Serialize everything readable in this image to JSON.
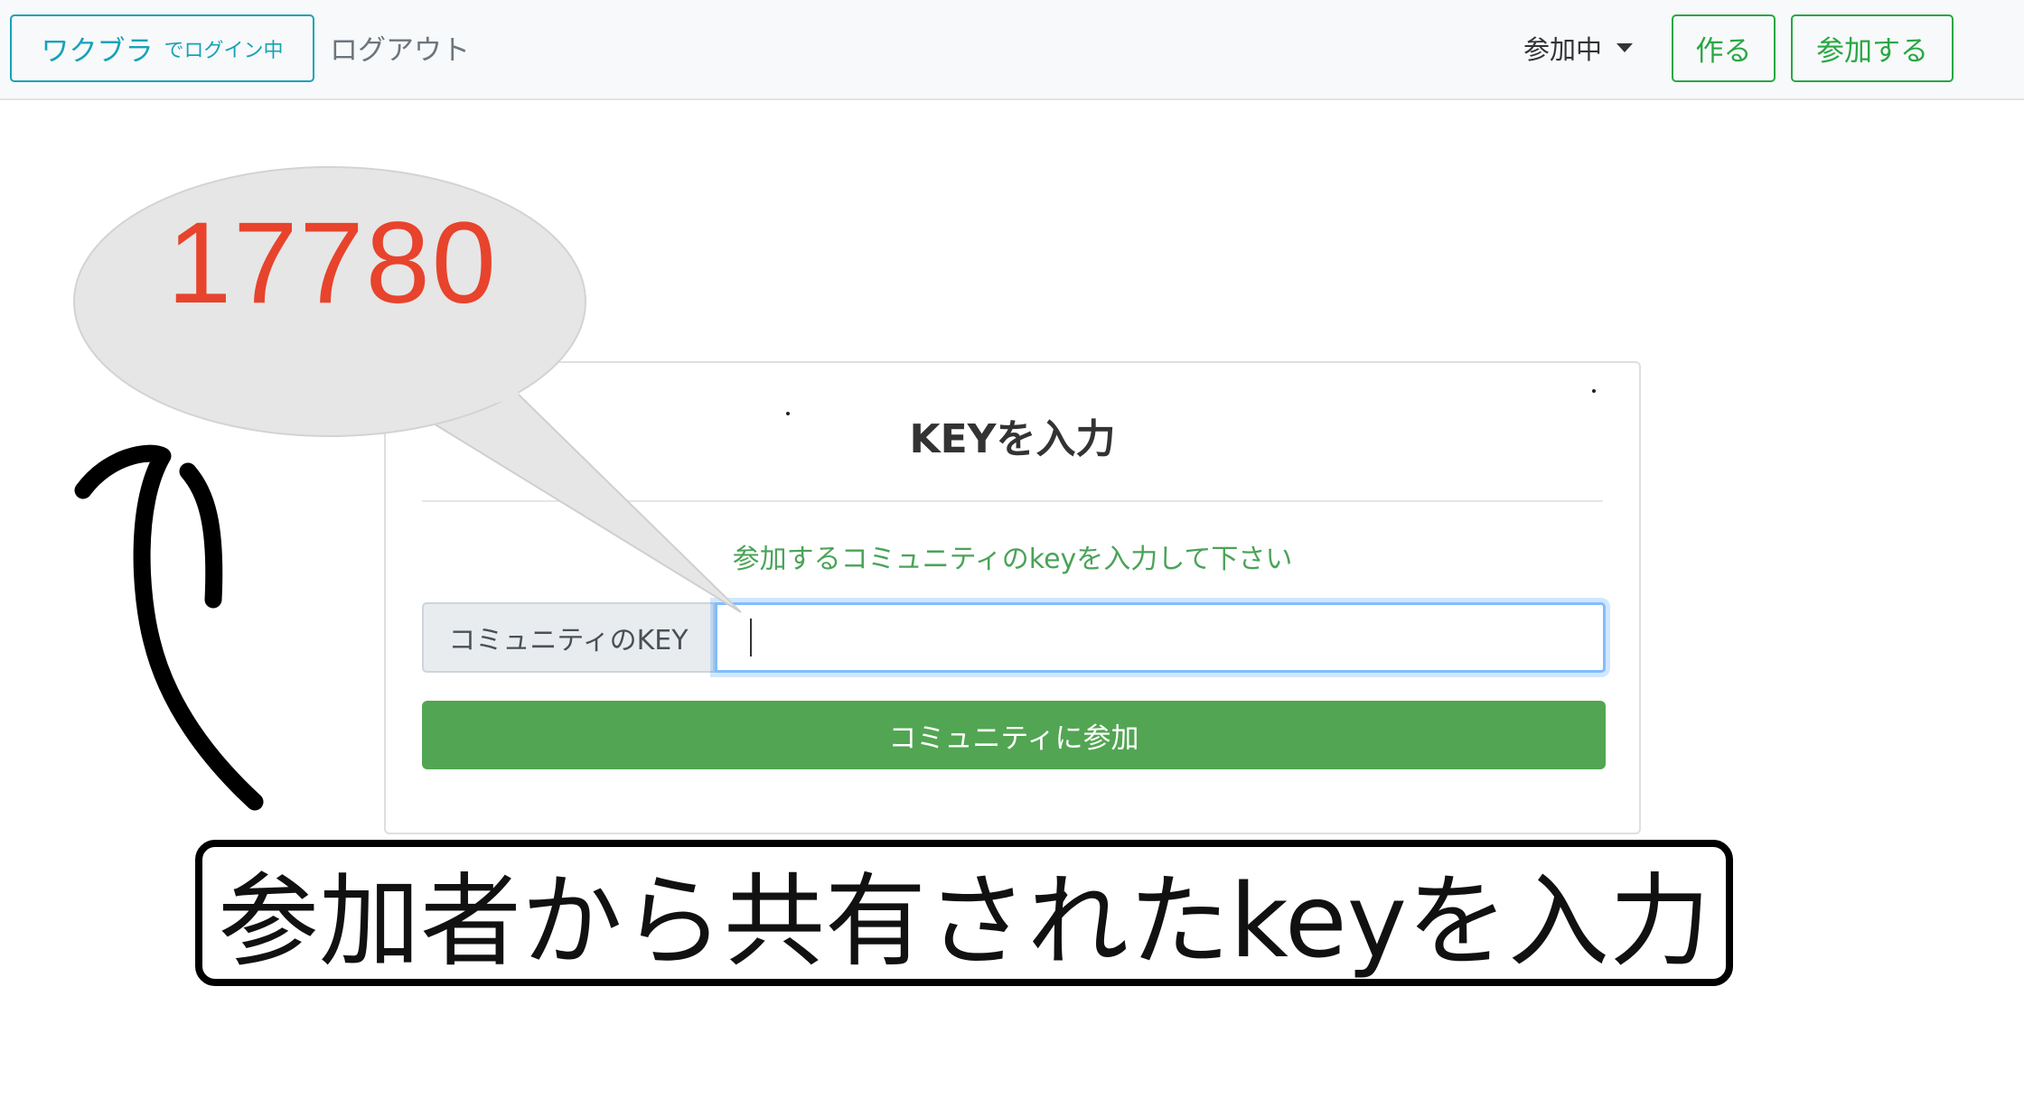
{
  "navbar": {
    "user_name": "ワクブラ",
    "user_status": "でログイン中",
    "logout_label": "ログアウト",
    "joining_label": "参加中",
    "create_label": "作る",
    "join_label": "参加する"
  },
  "card": {
    "title": "KEYを入力",
    "hint": "参加するコミュニティのkeyを入力して下さい",
    "input_prepend_label": "コミュニティのKEY",
    "input_value": "",
    "submit_label": "コミュニティに参加"
  },
  "annotation": {
    "bubble_number": "17780",
    "caption": "参加者から共有されたkeyを入力"
  },
  "colors": {
    "info": "#17a2b8",
    "success": "#28a745",
    "submit_bg": "#52a552",
    "hint_text": "#4aa358",
    "bubble_number": "#e8432c",
    "bubble_fill": "#e6e6e6"
  }
}
